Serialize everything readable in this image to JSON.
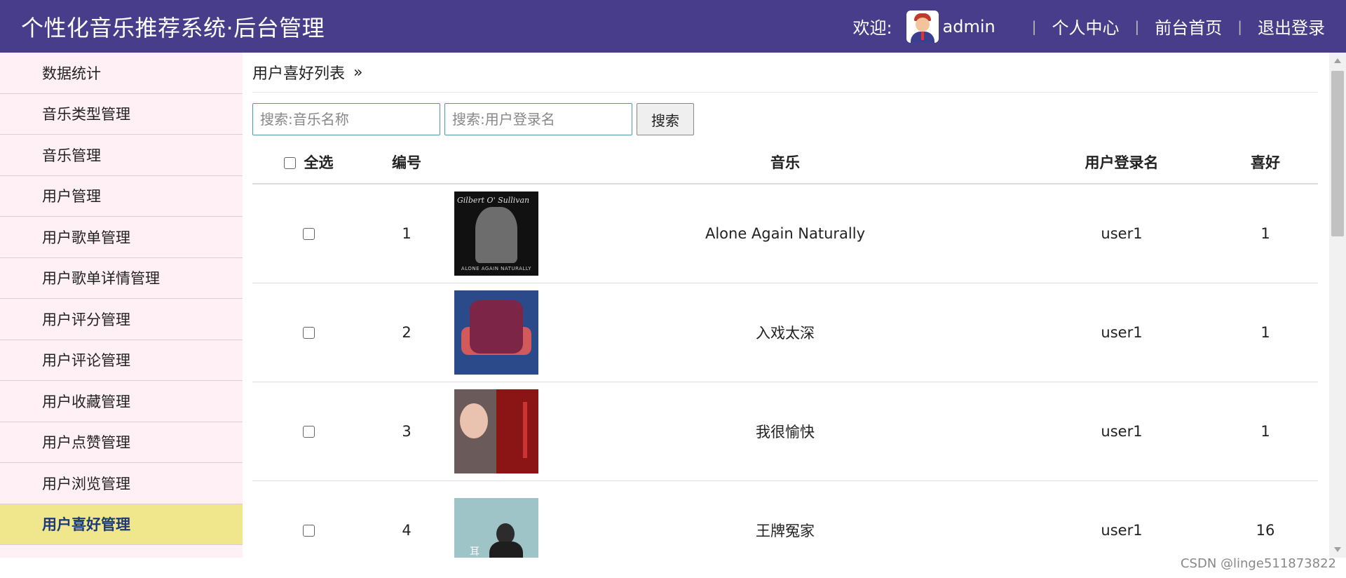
{
  "header": {
    "title": "个性化音乐推荐系统·后台管理",
    "welcome": "欢迎:",
    "username": "admin",
    "links": [
      "个人中心",
      "前台首页",
      "退出登录"
    ],
    "separator": "|"
  },
  "sidebar": {
    "items": [
      {
        "label": "数据统计",
        "active": false
      },
      {
        "label": "音乐类型管理",
        "active": false
      },
      {
        "label": "音乐管理",
        "active": false
      },
      {
        "label": "用户管理",
        "active": false
      },
      {
        "label": "用户歌单管理",
        "active": false
      },
      {
        "label": "用户歌单详情管理",
        "active": false
      },
      {
        "label": "用户评分管理",
        "active": false
      },
      {
        "label": "用户评论管理",
        "active": false
      },
      {
        "label": "用户收藏管理",
        "active": false
      },
      {
        "label": "用户点赞管理",
        "active": false
      },
      {
        "label": "用户浏览管理",
        "active": false
      },
      {
        "label": "用户喜好管理",
        "active": true
      }
    ]
  },
  "main": {
    "breadcrumb": "用户喜好列表",
    "breadcrumb_arrow": "»",
    "search": {
      "music_placeholder": "搜索:音乐名称",
      "user_placeholder": "搜索:用户登录名",
      "button": "搜索"
    },
    "table": {
      "headers": {
        "select_all": "全选",
        "id": "编号",
        "music": "音乐",
        "username": "用户登录名",
        "preference": "喜好"
      },
      "rows": [
        {
          "id": "1",
          "music": "Alone Again Naturally",
          "username": "user1",
          "preference": "1",
          "cover_title": "Gilbert O' Sullivan",
          "cover_caption": "ALONE AGAIN NATURALLY"
        },
        {
          "id": "2",
          "music": "入戏太深",
          "username": "user1",
          "preference": "1"
        },
        {
          "id": "3",
          "music": "我很愉快",
          "username": "user1",
          "preference": "1"
        },
        {
          "id": "4",
          "music": "王牌冤家",
          "username": "user1",
          "preference": "16",
          "cover_mark": "耳"
        }
      ]
    }
  },
  "watermark": "CSDN @linge511873822",
  "colors": {
    "header_bg": "#483d8b",
    "sidebar_bg": "#fff0f5",
    "sidebar_active_bg": "#f0e68c",
    "sidebar_active_text": "#1c3a7a"
  }
}
